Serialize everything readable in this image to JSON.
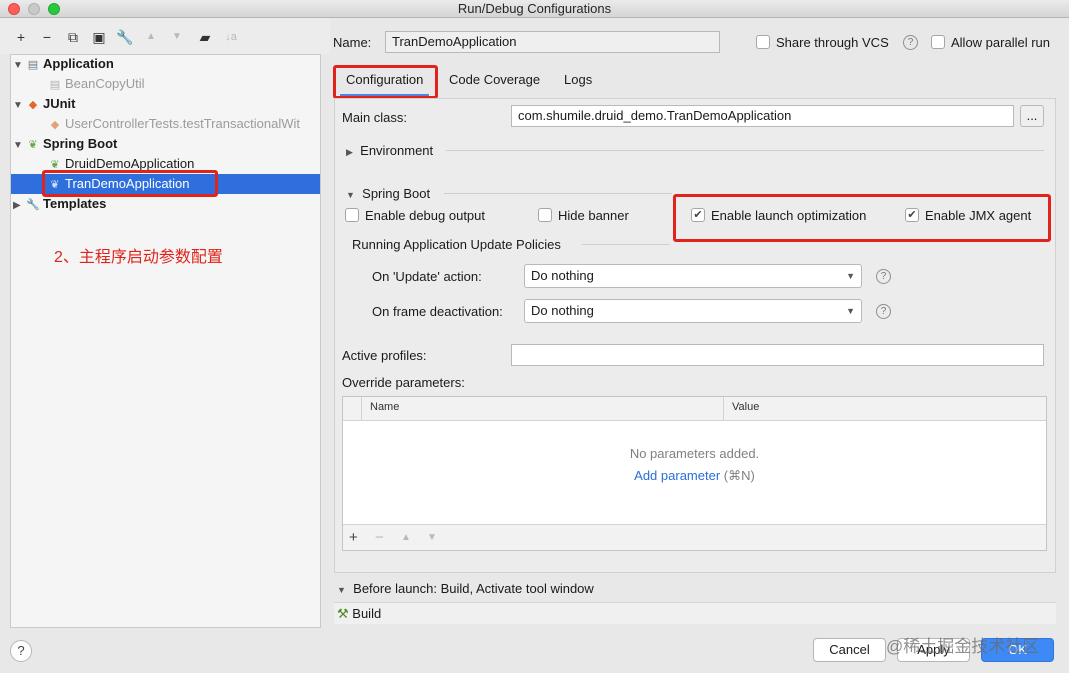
{
  "window": {
    "title": "Run/Debug Configurations"
  },
  "toolbar": {
    "add": "+",
    "remove": "−",
    "copy": "⧉",
    "save": "▣",
    "edit": "🔧",
    "up": "▲",
    "down": "▼",
    "folder": "▰",
    "sort": "↓a"
  },
  "tree": {
    "application": {
      "label": "Application",
      "child": "BeanCopyUtil"
    },
    "junit": {
      "label": "JUnit",
      "child": "UserControllerTests.testTransactionalWit"
    },
    "springboot": {
      "label": "Spring Boot",
      "children": [
        "DruidDemoApplication",
        "TranDemoApplication"
      ]
    },
    "templates": {
      "label": "Templates"
    }
  },
  "annotation": "2、主程序启动参数配置",
  "name_label": "Name:",
  "name_value": "TranDemoApplication",
  "share_vcs": "Share through VCS",
  "allow_parallel": "Allow parallel run",
  "tabs": [
    "Configuration",
    "Code Coverage",
    "Logs"
  ],
  "main_class_label": "Main class:",
  "main_class_value": "com.shumile.druid_demo.TranDemoApplication",
  "browse": "...",
  "environment": "Environment",
  "spring_boot_section": "Spring Boot",
  "options": {
    "debug_output": "Enable debug output",
    "hide_banner": "Hide banner",
    "launch_opt": "Enable launch optimization",
    "jmx": "Enable JMX agent"
  },
  "update_policies": "Running Application Update Policies",
  "on_update_label": "On 'Update' action:",
  "on_update_value": "Do nothing",
  "on_frame_label": "On frame deactivation:",
  "on_frame_value": "Do nothing",
  "active_profiles_label": "Active profiles:",
  "override_label": "Override parameters:",
  "table": {
    "col_name": "Name",
    "col_value": "Value",
    "empty": "No parameters added.",
    "add": "Add parameter",
    "shortcut": "(⌘N)"
  },
  "before_launch": "Before launch: Build, Activate tool window",
  "build": "Build",
  "buttons": {
    "help": "?",
    "cancel": "Cancel",
    "apply": "Apply",
    "ok": "OK"
  },
  "watermark": "@稀土掘金技术社区"
}
